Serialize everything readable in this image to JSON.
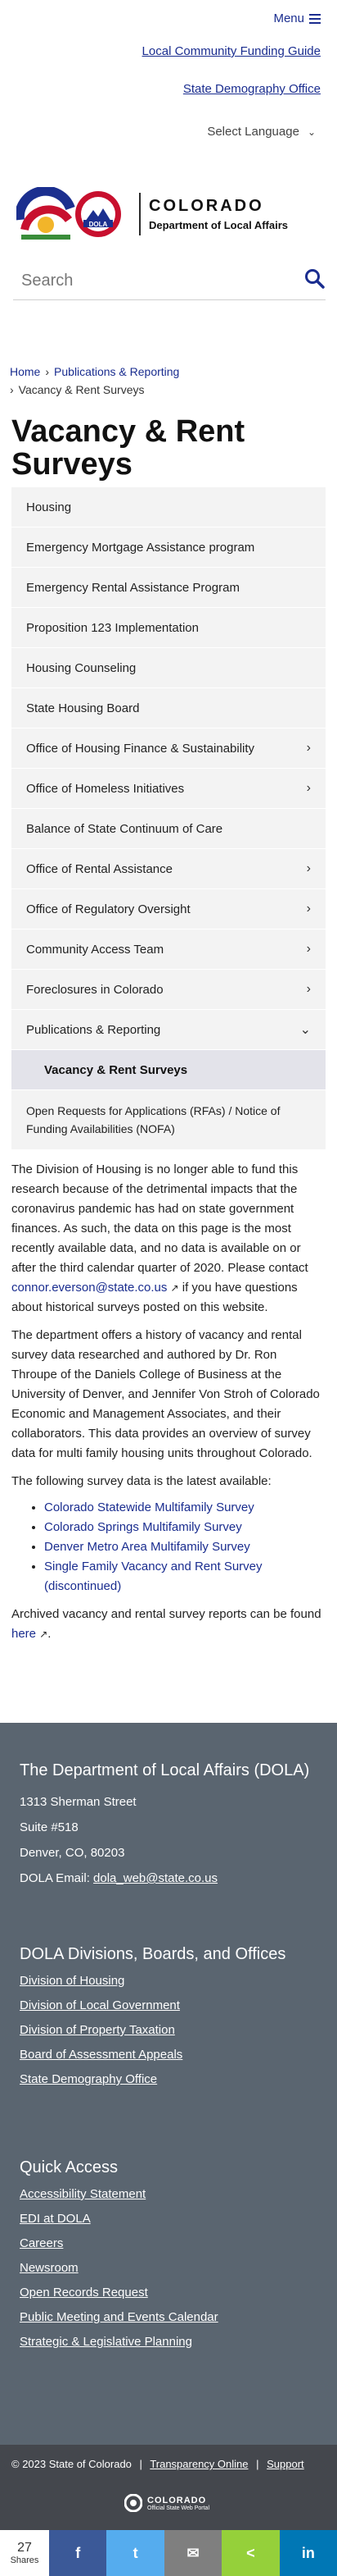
{
  "header": {
    "menu_label": "Menu",
    "links": [
      "Local Community Funding Guide",
      "State Demography Office"
    ],
    "language_label": "Select Language",
    "logo": {
      "dola_text": "DOLA",
      "line1": "COLORADO",
      "line2": "Department of Local Affairs"
    },
    "search_placeholder": "Search"
  },
  "breadcrumb": {
    "home": "Home",
    "parent": "Publications & Reporting",
    "current": "Vacancy & Rent Surveys",
    "separator": "›"
  },
  "page_title": "Vacancy & Rent Surveys",
  "sidenav": {
    "items": [
      {
        "label": "Housing",
        "has_arrow": false
      },
      {
        "label": "Emergency Mortgage Assistance program",
        "has_arrow": false
      },
      {
        "label": "Emergency Rental Assistance Program",
        "has_arrow": false
      },
      {
        "label": "Proposition 123 Implementation",
        "has_arrow": false
      },
      {
        "label": "Housing Counseling",
        "has_arrow": false
      },
      {
        "label": "State Housing Board",
        "has_arrow": false
      },
      {
        "label": "Office of Housing Finance & Sustainability",
        "has_arrow": true
      },
      {
        "label": "Office of Homeless Initiatives",
        "has_arrow": true
      },
      {
        "label": "Balance of State Continuum of Care",
        "has_arrow": false
      },
      {
        "label": "Office of Rental Assistance",
        "has_arrow": true
      },
      {
        "label": "Office of Regulatory Oversight",
        "has_arrow": true
      },
      {
        "label": "Community Access Team",
        "has_arrow": true
      },
      {
        "label": "Foreclosures in Colorado",
        "has_arrow": true
      },
      {
        "label": "Publications & Reporting",
        "has_arrow": true
      }
    ],
    "arrow_right": "›",
    "arrow_down": "⌄",
    "sub_active": "Vacancy & Rent Surveys",
    "sub_other": "Open Requests for Applications (RFAs) / Notice of Funding Availabilities (NOFA)"
  },
  "content": {
    "p1_before": "The Division of Housing is no longer able to fund this research because of the detrimental impacts that the coronavirus pandemic has had on state government finances. As such, the data on this page is the most recently available data, and no data is available on or after the third calendar quarter of 2020. Please contact ",
    "p1_link": "connor.everson@state.co.us",
    "p1_after": " if you have questions about historical surveys posted on this website.",
    "p2": "The department offers a history of vacancy and rental survey data researched and authored by Dr. Ron Throupe of the Daniels College of Business at the University of Denver, and Jennifer Von Stroh of Colorado Economic and Management Associates, and their collaborators. This data provides an overview of survey data for multi family housing units throughout Colorado.",
    "p3": "The following survey data is the latest available:",
    "list": [
      "Colorado Statewide Multifamily Survey",
      "Colorado Springs Multifamily Survey",
      "Denver Metro Area Multifamily Survey",
      "Single Family Vacancy and Rent Survey (discontinued)"
    ],
    "p4_before": "Archived vacancy and rental survey reports can be found ",
    "p4_link": "here",
    "p4_after": "."
  },
  "footer": {
    "dept_title": "The Department of Local Affairs (DOLA)",
    "address1": "1313 Sherman Street",
    "address2": "Suite  #518",
    "address3": "Denver, CO, 80203",
    "email_label": "DOLA Email: ",
    "email": "dola_web@state.co.us",
    "divisions_title": "DOLA Divisions, Boards, and Offices",
    "divisions": [
      "Division of Housing",
      "Division of Local Government",
      "Division of Property Taxation",
      "Board of Assessment Appeals",
      "State Demography Office"
    ],
    "quick_title": "Quick Access",
    "quick": [
      "Accessibility Statement",
      "EDI at DOLA",
      "Careers",
      "Newsroom",
      "Open Records Request",
      "Public Meeting and Events Calendar",
      "Strategic & Legislative Planning"
    ]
  },
  "bottom": {
    "copyright": "© 2023 State of Colorado",
    "transparency": "Transparency Online",
    "support": "Support",
    "sep": "|",
    "portal_line1": "COLORADO",
    "portal_line2": "Official State Web Portal"
  },
  "share": {
    "count": "27",
    "label": "Shares",
    "buttons": [
      {
        "icon": "facebook-icon",
        "glyph": "f",
        "color": "#3b5998"
      },
      {
        "icon": "twitter-icon",
        "glyph": "t",
        "color": "#55acee"
      },
      {
        "icon": "email-icon",
        "glyph": "✉",
        "color": "#7f7f7f"
      },
      {
        "icon": "share-icon",
        "glyph": "<",
        "color": "#95d03a"
      },
      {
        "icon": "linkedin-icon",
        "glyph": "in",
        "color": "#0077b5"
      }
    ]
  },
  "colors": {
    "link": "#1a2d8f",
    "footer_bg": "#5a6570",
    "bottom_bg": "#44474d",
    "nav_bg": "#f3f3f3",
    "nav_active_bg": "#e3e3ea"
  }
}
